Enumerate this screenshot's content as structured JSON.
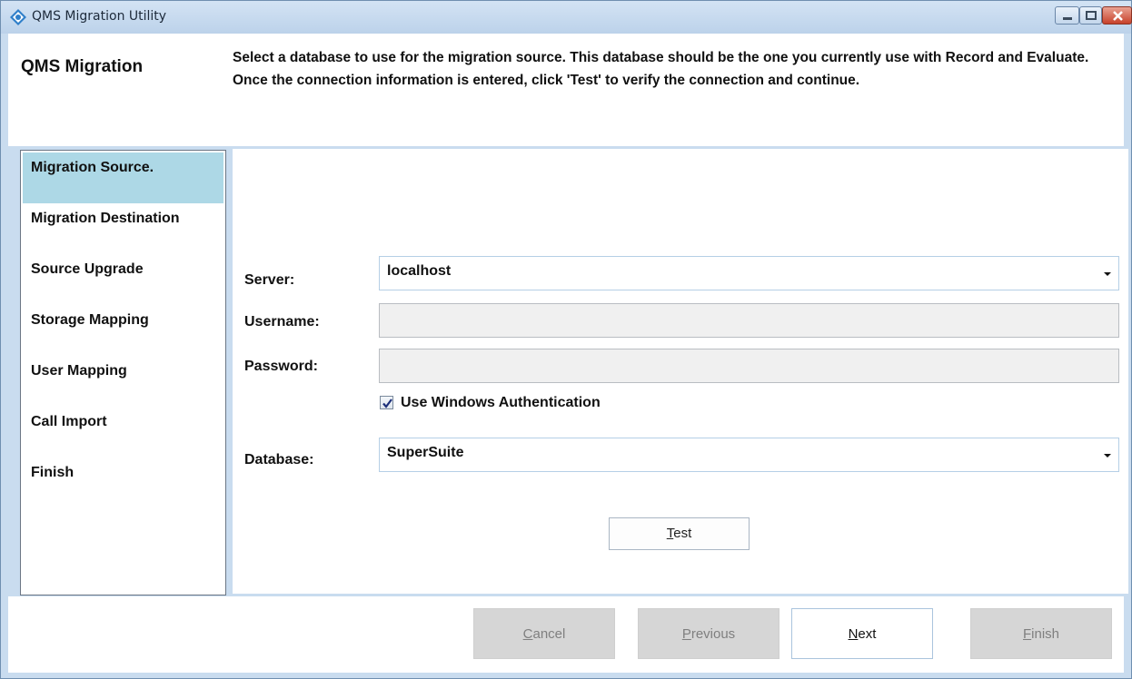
{
  "window": {
    "title": "QMS Migration Utility",
    "accent_color": "#c9dcef",
    "icons": {
      "app": "qms-diamond-icon",
      "minimize": "minimize-icon",
      "maximize": "maximize-icon",
      "close": "close-icon"
    }
  },
  "header": {
    "title": "QMS Migration",
    "description": "Select a database to use for the migration source.  This database should be the one you currently use with Record and Evaluate.  Once the connection information is entered, click 'Test' to verify the connection and continue."
  },
  "sidebar": {
    "items": [
      {
        "label": "Migration Source.",
        "active": true
      },
      {
        "label": "Migration Destination",
        "active": false
      },
      {
        "label": "Source Upgrade",
        "active": false
      },
      {
        "label": "Storage Mapping",
        "active": false
      },
      {
        "label": "User Mapping",
        "active": false
      },
      {
        "label": "Call Import",
        "active": false
      },
      {
        "label": "Finish",
        "active": false
      }
    ],
    "active_color": "#add8e6"
  },
  "form": {
    "server_label": "Server:",
    "server_value": "localhost",
    "username_label": "Username:",
    "username_value": "",
    "password_label": "Password:",
    "password_value": "",
    "windows_auth_label": "Use Windows Authentication",
    "windows_auth_checked": true,
    "database_label": "Database:",
    "database_value": "SuperSuite",
    "test_button": {
      "mnemonic": "T",
      "rest": "est"
    }
  },
  "footer": {
    "cancel": {
      "mnemonic": "C",
      "rest": "ancel",
      "enabled": false
    },
    "previous": {
      "mnemonic": "P",
      "rest": "revious",
      "enabled": false
    },
    "next": {
      "mnemonic": "N",
      "rest": "ext",
      "enabled": true
    },
    "finish": {
      "mnemonic": "F",
      "rest": "inish",
      "enabled": false
    }
  }
}
